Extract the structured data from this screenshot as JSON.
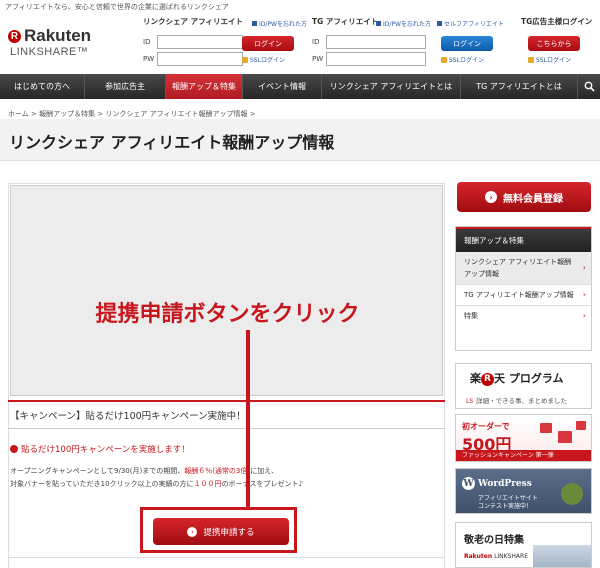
{
  "header": {
    "tagline": "アフィリエイトなら、安心と信頼で世界の企業に選ばれるリンクシェア",
    "logo": {
      "mark": "R",
      "brand": "Rakuten",
      "sub": "LINKSHARE™"
    },
    "login_ls": {
      "title": "リンクシェア アフィリエイト",
      "forgot_link": "ID/PWを忘れた方",
      "id_label": "ID",
      "pw_label": "PW",
      "button": "ログイン",
      "ssl": "SSLログイン"
    },
    "login_tg": {
      "title": "TG アフィリエイト",
      "forgot_link": "ID/PWを忘れた方",
      "self_link": "セルフアフィリエイト",
      "id_label": "ID",
      "pw_label": "PW",
      "button": "ログイン",
      "ssl": "SSLログイン"
    },
    "login_adv": {
      "title": "TG広告主様ログイン",
      "button": "こちらから",
      "ssl": "SSLログイン"
    }
  },
  "nav": {
    "items": [
      {
        "label": "はじめての方へ"
      },
      {
        "label": "参加広告主"
      },
      {
        "label": "報酬アップ＆特集"
      },
      {
        "label": "イベント情報"
      },
      {
        "label": "リンクシェア アフィリエイトとは"
      },
      {
        "label": "TG アフィリエイトとは"
      }
    ],
    "active_index": 2
  },
  "breadcrumb": "ホーム > 報酬アップ＆特集 > リンクシェア アフィリエイト報酬アップ情報 >",
  "page_title": "リンクシェア アフィリエイト報酬アップ情報",
  "main": {
    "banner_caption": "提携申請ボタンをクリック",
    "campaign_title": "【キャンペーン】貼るだけ100円キャンペーン実施中！",
    "campaign_subtitle": "貼るだけ100円キャンペーンを実施します！",
    "body_line1_a": "オープニングキャンペーンとして9/30(月)までの期間、",
    "body_line1_red": "報酬６％(通常の3倍)",
    "body_line1_b": "に加え、",
    "body_line2_a": "対象バナーを貼っていただき10クリック以上の実績の方に",
    "body_line2_red": "１００円",
    "body_line2_b": "のボーナスをプレゼント♪",
    "apply_button": "提携申請する",
    "highlight_color": "#c8161d"
  },
  "sidebar": {
    "register_button": "無料会員登録",
    "panel_title": "報酬アップ＆特集",
    "items": [
      {
        "label": "リンクシェア アフィリエイト報酬アップ情報",
        "selected": true
      },
      {
        "label": "TG アフィリエイト報酬アップ情報",
        "selected": false
      },
      {
        "label": "特集",
        "selected": false
      }
    ],
    "ad_rakuten": {
      "title_a": "楽",
      "title_mark": "R",
      "title_b": "天 プログラム",
      "tag": "LS",
      "sub": "詳細・できる事、まとめました"
    },
    "ad_fashion": {
      "line1": "初オーダーで",
      "line2": "500円",
      "line3": "ファッションキャンペーン 第一弾"
    },
    "ad_wordpress": {
      "logo": "WordPress",
      "line1": "アフィリエイトサイト",
      "line2": "コンテスト実施中！"
    },
    "ad_keirou": {
      "title": "敬老の日特集",
      "logo_brand": "Rakuten",
      "logo_sub": "LINKSHARE"
    }
  }
}
